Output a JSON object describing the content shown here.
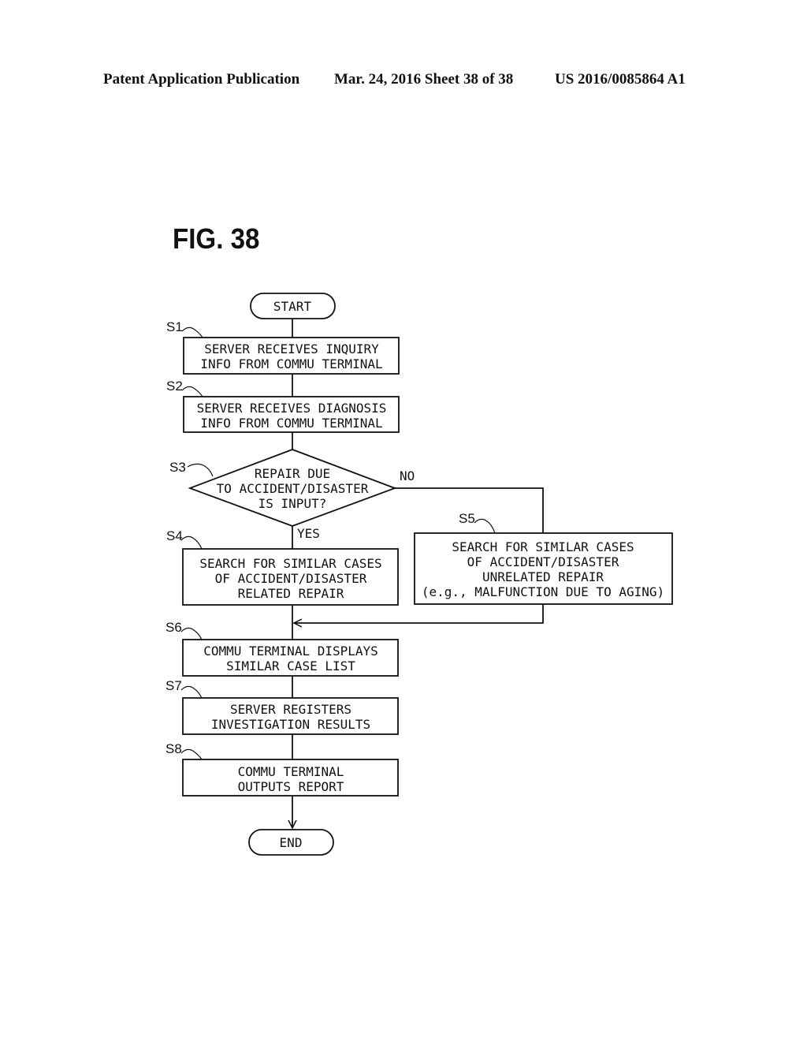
{
  "header": {
    "publication": "Patent Application Publication",
    "date_sheet": "Mar. 24, 2016  Sheet 38 of 38",
    "number": "US 2016/0085864 A1"
  },
  "figure": {
    "title": "FIG. 38",
    "start": "START",
    "end": "END",
    "steps": {
      "s1": {
        "label": "S1",
        "lines": [
          "SERVER RECEIVES INQUIRY",
          "INFO FROM COMMU TERMINAL"
        ]
      },
      "s2": {
        "label": "S2",
        "lines": [
          "SERVER RECEIVES DIAGNOSIS",
          "INFO FROM COMMU TERMINAL"
        ]
      },
      "s3": {
        "label": "S3",
        "lines": [
          "REPAIR DUE",
          "TO ACCIDENT/DISASTER",
          "IS INPUT?"
        ]
      },
      "s4": {
        "label": "S4",
        "lines": [
          "SEARCH FOR SIMILAR CASES",
          "OF ACCIDENT/DISASTER",
          "RELATED REPAIR"
        ]
      },
      "s5": {
        "label": "S5",
        "lines": [
          "SEARCH FOR SIMILAR CASES",
          "OF ACCIDENT/DISASTER",
          "UNRELATED REPAIR",
          "(e.g.,  MALFUNCTION DUE TO AGING)"
        ]
      },
      "s6": {
        "label": "S6",
        "lines": [
          "COMMU TERMINAL DISPLAYS",
          "SIMILAR CASE LIST"
        ]
      },
      "s7": {
        "label": "S7",
        "lines": [
          "SERVER REGISTERS",
          "INVESTIGATION RESULTS"
        ]
      },
      "s8": {
        "label": "S8",
        "lines": [
          "COMMU TERMINAL",
          "OUTPUTS REPORT"
        ]
      }
    },
    "branch_no": "NO",
    "branch_yes": "YES"
  }
}
